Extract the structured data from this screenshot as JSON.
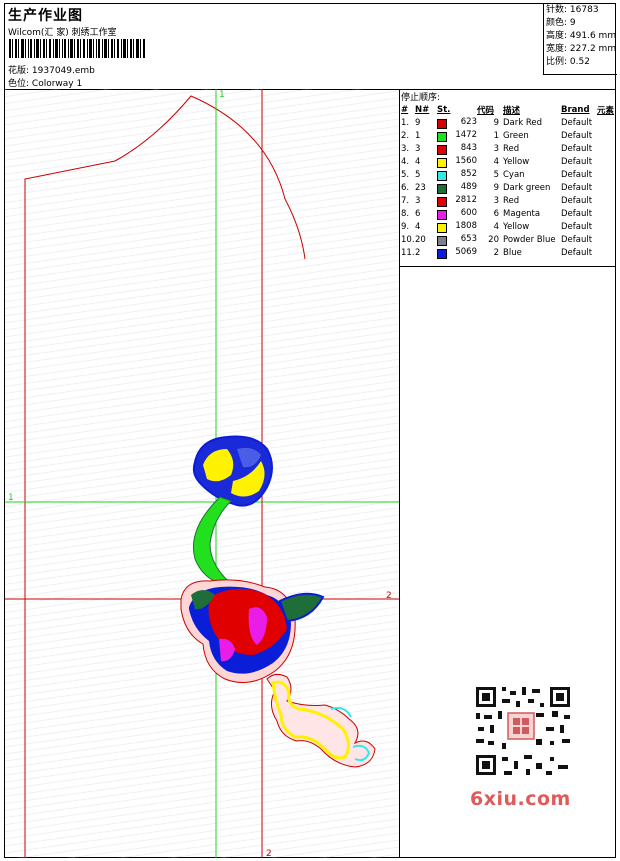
{
  "header": {
    "title": "生产作业图",
    "company": "Wilcom(汇 家) 刺绣工作室",
    "design_label": "花版:",
    "design_file": "1937049.emb",
    "colorway_label": "色位:",
    "colorway": "Colorway 1"
  },
  "stats": [
    {
      "label": "针数:",
      "value": "16783"
    },
    {
      "label": "颜色:",
      "value": "9"
    },
    {
      "label": "高度:",
      "value": "491.6 mm"
    },
    {
      "label": "宽度:",
      "value": "227.2 mm"
    },
    {
      "label": "比例:",
      "value": "0.52"
    }
  ],
  "stop_sequence": {
    "title": "停止顺序:",
    "columns": [
      "#",
      "N#",
      "St.",
      "代码",
      "描述",
      "Brand",
      "元素"
    ],
    "rows": [
      {
        "idx": "1.",
        "n": "9",
        "color": "#d40000",
        "st": "623",
        "code": "9",
        "desc": "Dark Red",
        "brand": "Default"
      },
      {
        "idx": "2.",
        "n": "1",
        "color": "#22e01e",
        "st": "1472",
        "code": "1",
        "desc": "Green",
        "brand": "Default"
      },
      {
        "idx": "3.",
        "n": "3",
        "color": "#e00000",
        "st": "843",
        "code": "3",
        "desc": "Red",
        "brand": "Default"
      },
      {
        "idx": "4.",
        "n": "4",
        "color": "#fff200",
        "st": "1560",
        "code": "4",
        "desc": "Yellow",
        "brand": "Default"
      },
      {
        "idx": "5.",
        "n": "5",
        "color": "#39e6e6",
        "st": "852",
        "code": "5",
        "desc": "Cyan",
        "brand": "Default"
      },
      {
        "idx": "6.",
        "n": "23",
        "color": "#1f6e3a",
        "st": "489",
        "code": "9",
        "desc": "Dark green",
        "brand": "Default"
      },
      {
        "idx": "7.",
        "n": "3",
        "color": "#e00000",
        "st": "2812",
        "code": "3",
        "desc": "Red",
        "brand": "Default"
      },
      {
        "idx": "8.",
        "n": "6",
        "color": "#e81ee8",
        "st": "600",
        "code": "6",
        "desc": "Magenta",
        "brand": "Default"
      },
      {
        "idx": "9.",
        "n": "4",
        "color": "#fff200",
        "st": "1808",
        "code": "4",
        "desc": "Yellow",
        "brand": "Default"
      },
      {
        "idx": "10.",
        "n": "20",
        "color": "#7a7f8a",
        "st": "653",
        "code": "20",
        "desc": "Powder Blue",
        "brand": "Default"
      },
      {
        "idx": "11.",
        "n": "2",
        "color": "#0a1ed8",
        "st": "5069",
        "code": "2",
        "desc": "Blue",
        "brand": "Default"
      }
    ]
  },
  "axes": {
    "v1": "1",
    "h1": "1",
    "h2": "2",
    "v2": "2"
  },
  "watermark": "6xiu.com",
  "colors": {
    "guide_green": "#1fd31f",
    "guide_red": "#cc0000",
    "outline": "#cc0000"
  }
}
